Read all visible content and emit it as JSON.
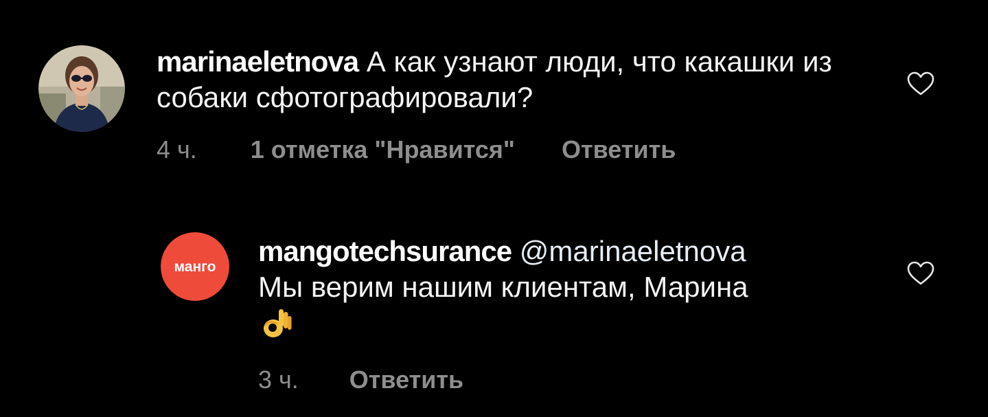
{
  "comments": [
    {
      "username": "marinaeletnova",
      "text": "А как узнают люди, что какашки из собаки сфотографировали?",
      "time": "4 ч.",
      "likes": "1 отметка \"Нравится\"",
      "reply": "Ответить",
      "avatar_icon": "user-photo"
    },
    {
      "username": "mangotechsurance",
      "mention": "@marinaeletnova",
      "text": "Мы верим нашим клиентам, Марина",
      "emoji": "👌",
      "time": "3 ч.",
      "reply": "Ответить",
      "avatar_label": "манго",
      "avatar_color": "#ef4b3b"
    }
  ],
  "colors": {
    "background": "#000000",
    "text": "#f5f5f5",
    "meta": "#8e8e8e",
    "brand": "#ef4b3b"
  },
  "icons": [
    "heart-outline-icon",
    "ok-hand-emoji"
  ]
}
